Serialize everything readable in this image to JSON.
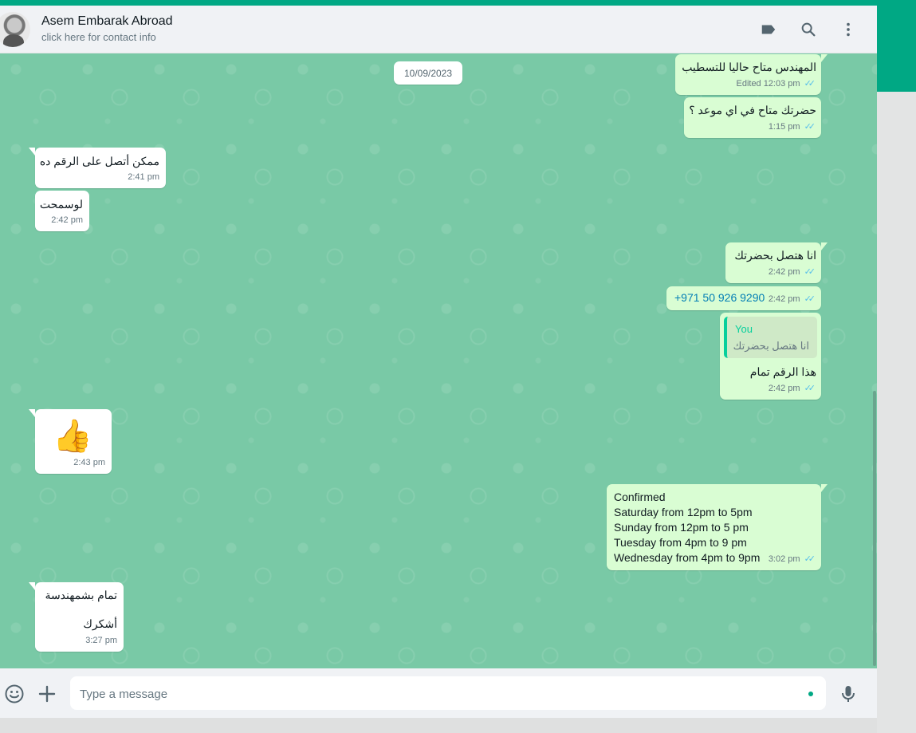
{
  "colors": {
    "accent": "#00a884",
    "chat_background": "#79c9a6",
    "outgoing_bubble": "#d9fdd3",
    "incoming_bubble": "#ffffff",
    "read_ticks": "#53bdeb",
    "header_background": "#f0f2f5"
  },
  "header": {
    "contact_name": "Asem Embarak Abroad",
    "contact_subtitle": "click here for contact info",
    "icons": [
      "label-icon",
      "search-icon",
      "menu-icon"
    ]
  },
  "chat": {
    "date_chip": "10/09/2023",
    "messages": [
      {
        "direction": "out",
        "text": "المهندس متاح حاليا للتسطيب",
        "edited_label": "Edited",
        "time": "12:03 pm",
        "status": "read"
      },
      {
        "direction": "out",
        "text": "حضرتك متاح في اي موعد ؟",
        "time": "1:15 pm",
        "status": "read"
      },
      {
        "direction": "in",
        "text": "ممكن أتصل على الرقم ده",
        "time": "2:41 pm"
      },
      {
        "direction": "in",
        "text": "لوسمحت",
        "time": "2:42 pm"
      },
      {
        "direction": "out",
        "text": "انا هتصل بحضرتك",
        "time": "2:42 pm",
        "status": "read"
      },
      {
        "direction": "out",
        "text": "+971 50 926 9290",
        "time": "2:42 pm",
        "status": "read"
      },
      {
        "direction": "out",
        "quote_author": "You",
        "quote_text": "انا هتصل بحضرتك",
        "text": "هذا الرقم تمام",
        "time": "2:42 pm",
        "status": "read"
      },
      {
        "direction": "in",
        "emoji": "👍",
        "time": "2:43 pm"
      },
      {
        "direction": "out",
        "lines": [
          "Confirmed",
          "Saturday from 12pm to 5pm",
          "Sunday from 12pm to 5 pm",
          "Tuesday from 4pm to 9 pm",
          "Wednesday from 4pm to 9pm"
        ],
        "time": "3:02 pm",
        "status": "read"
      },
      {
        "direction": "in",
        "lines": [
          "تمام بشمهندسة",
          "أشكرك"
        ],
        "time": "3:27 pm"
      }
    ]
  },
  "footer": {
    "placeholder": "Type a message",
    "value": ""
  }
}
